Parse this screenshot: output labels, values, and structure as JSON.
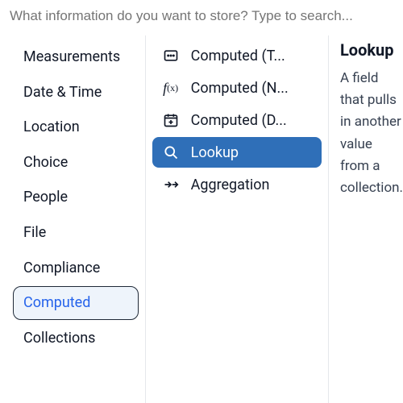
{
  "search": {
    "placeholder": "What information do you want to store? Type to search..."
  },
  "categories": [
    {
      "label": "Measurements",
      "selected": false
    },
    {
      "label": "Date & Time",
      "selected": false
    },
    {
      "label": "Location",
      "selected": false
    },
    {
      "label": "Choice",
      "selected": false
    },
    {
      "label": "People",
      "selected": false
    },
    {
      "label": "File",
      "selected": false
    },
    {
      "label": "Compliance",
      "selected": false
    },
    {
      "label": "Computed",
      "selected": true
    },
    {
      "label": "Collections",
      "selected": false
    }
  ],
  "types": [
    {
      "icon": "text-icon",
      "label": "Computed (T...",
      "selected": false
    },
    {
      "icon": "fx-icon",
      "label": "Computed (N...",
      "selected": false
    },
    {
      "icon": "calendar-icon",
      "label": "Computed (D...",
      "selected": false
    },
    {
      "icon": "search-icon",
      "label": "Lookup",
      "selected": true
    },
    {
      "icon": "aggregation-icon",
      "label": "Aggregation",
      "selected": false
    }
  ],
  "detail": {
    "title": "Lookup",
    "description": "A field that pulls in another value from a collection."
  }
}
